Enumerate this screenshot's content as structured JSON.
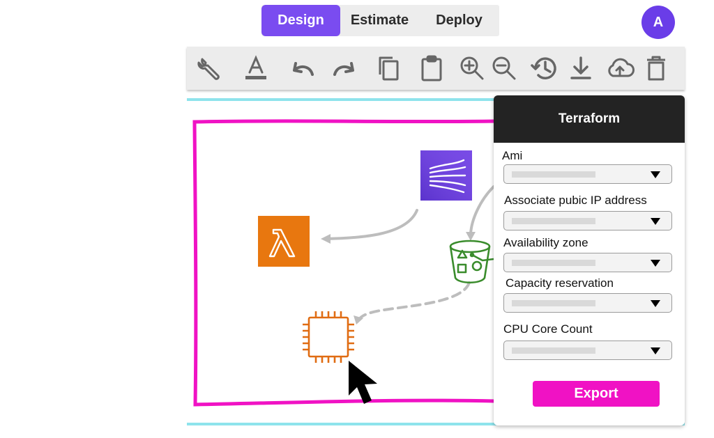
{
  "tabs": [
    {
      "label": "Design",
      "active": true
    },
    {
      "label": "Estimate",
      "active": false
    },
    {
      "label": "Deploy",
      "active": false
    }
  ],
  "avatar": {
    "initial": "A"
  },
  "toolbar": {
    "icons": [
      "wrench-icon",
      "text-color-icon",
      "undo-icon",
      "redo-icon",
      "copy-icon",
      "paste-icon",
      "zoom-in-icon",
      "zoom-out-icon",
      "history-icon",
      "download-icon",
      "upload-cloud-icon",
      "delete-icon"
    ]
  },
  "canvas": {
    "frame_color": "#f012c4",
    "nodes": [
      "kinesis-icon",
      "lambda-icon",
      "s3-bucket-icon",
      "ec2-instance-icon"
    ]
  },
  "panel": {
    "title": "Terraform",
    "fields": [
      {
        "label": "Ami"
      },
      {
        "label": "Associate pubic IP address"
      },
      {
        "label": "Availability zone"
      },
      {
        "label": "Capacity reservation"
      },
      {
        "label": "CPU Core Count"
      }
    ],
    "export_label": "Export"
  },
  "colors": {
    "accent": "#7a4cf0",
    "export": "#f012c4",
    "canvas_border": "#8ee3ec"
  }
}
